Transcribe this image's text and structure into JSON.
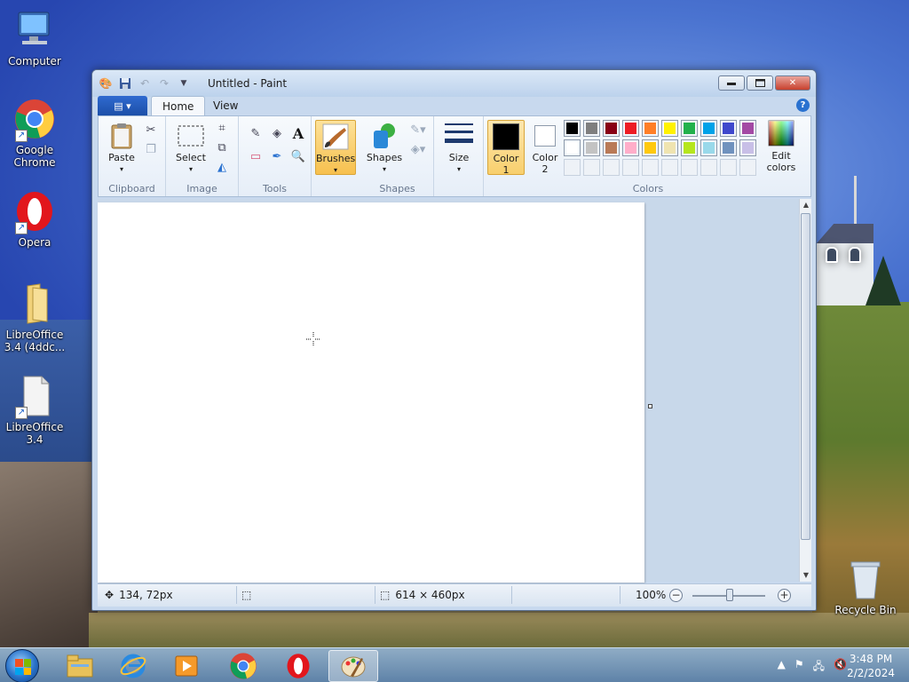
{
  "desktop": {
    "icons": [
      {
        "label": "Computer"
      },
      {
        "label": "Google Chrome"
      },
      {
        "label": "Opera"
      },
      {
        "label": "LibreOffice 3.4 (4ddc..."
      },
      {
        "label": "LibreOffice 3.4"
      },
      {
        "label": "Recycle Bin"
      }
    ]
  },
  "window": {
    "title": "Untitled - Paint",
    "tabs": [
      {
        "label": "Home"
      },
      {
        "label": "View"
      }
    ],
    "help": "?"
  },
  "ribbon": {
    "clipboard": {
      "label": "Clipboard",
      "paste": "Paste"
    },
    "image": {
      "label": "Image",
      "select": "Select"
    },
    "tools": {
      "label": "Tools",
      "text_glyph": "A"
    },
    "brushes": {
      "label": "Brushes"
    },
    "shapes": {
      "label": "Shapes",
      "shapes_btn": "Shapes"
    },
    "size": {
      "label": "Size"
    },
    "colors": {
      "label": "Colors",
      "color1": "Color 1",
      "color1_l1": "Color",
      "color1_l2": "1",
      "color2_l1": "Color",
      "color2_l2": "2",
      "edit_l1": "Edit",
      "edit_l2": "colors",
      "row1": [
        "#000000",
        "#7f7f7f",
        "#880015",
        "#ed1c24",
        "#ff7f27",
        "#fff200",
        "#22b14c",
        "#00a2e8",
        "#3f48cc",
        "#a349a4"
      ],
      "row2": [
        "#ffffff",
        "#c3c3c3",
        "#b97a57",
        "#ffaec9",
        "#ffc90e",
        "#efe4b0",
        "#b5e61d",
        "#99d9ea",
        "#7092be",
        "#c8bfe7"
      ]
    }
  },
  "status": {
    "cursor_pos": "134, 72px",
    "canvas_size": "614 × 460px",
    "zoom": "100%"
  },
  "taskbar": {
    "time": "3:48 PM",
    "date": "2/2/2024"
  }
}
